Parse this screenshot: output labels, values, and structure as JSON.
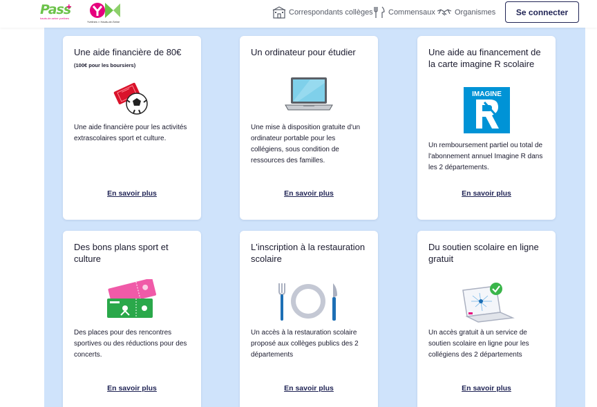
{
  "header": {
    "logo_pass": {
      "word": "Pass",
      "plus": "+",
      "tagline": "hauts-de-seine yvelines"
    },
    "logo_yk": {
      "tagline": "Yvelines × Hauts-de-Seine"
    },
    "nav": [
      {
        "label": "Correspondants collèges",
        "icon": "building-icon"
      },
      {
        "label": "Commensaux",
        "icon": "fork-knife-icon"
      },
      {
        "label": "Organismes",
        "icon": "handshake-icon"
      }
    ],
    "login_label": "Se connecter"
  },
  "colors": {
    "accent_navy": "#1f2354",
    "background_blue": "#cfe3fb",
    "pass_green": "#6cc24a",
    "pass_pink": "#e6007e",
    "imagine_blue": "#0093d6",
    "fork_blue": "#1d6fb5"
  },
  "cards": [
    {
      "title": "Une aide financière de 80€",
      "note": "(100€ pour les boursiers)",
      "illustration": "ticket-ball-icon",
      "description": "Une aide financière pour les activités extrascolaires sport et culture.",
      "link": "En savoir plus"
    },
    {
      "title": "Un ordinateur pour étudier",
      "note": "",
      "illustration": "laptop-icon",
      "description": "Une mise à disposition gratuite d'un ordinateur portable pour les collégiens, sous condition de ressources des familles.",
      "link": "En savoir plus"
    },
    {
      "title": "Une aide au financement de la carte imagine R scolaire",
      "note": "",
      "illustration": "imagine-r-logo",
      "description": "Un remboursement partiel ou total de l'abonnement annuel Imagine R dans les 2 départements.",
      "link": "En savoir plus"
    },
    {
      "title": "Des bons plans sport et culture",
      "note": "",
      "illustration": "tickets-icon",
      "description": "Des places pour des rencontres sportives ou des réductions pour des concerts.",
      "link": "En savoir plus"
    },
    {
      "title": "L'inscription à la restauration scolaire",
      "note": "",
      "illustration": "plate-cutlery-icon",
      "description": "Un accès à la restauration scolaire proposé aux collèges publics des 2 départements",
      "link": "En savoir plus"
    },
    {
      "title": "Du soutien scolaire en ligne gratuit",
      "note": "",
      "illustration": "laptop-check-icon",
      "description": "Un accès gratuit à un service de soutien scolaire en ligne pour les collégiens des 2 départements",
      "link": "En savoir plus"
    }
  ]
}
